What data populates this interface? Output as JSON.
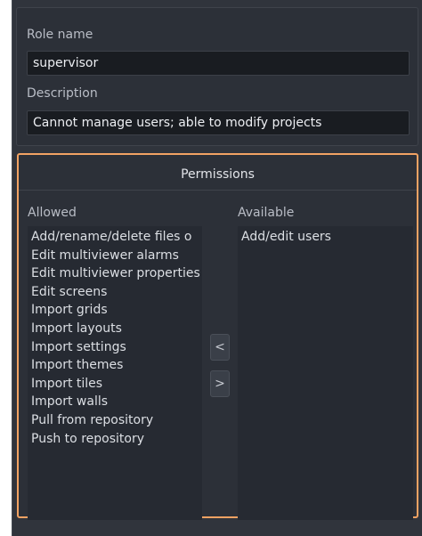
{
  "role": {
    "name_label": "Role name",
    "name_value": "supervisor",
    "description_label": "Description",
    "description_value": "Cannot manage users; able to modify projects"
  },
  "permissions": {
    "title": "Permissions",
    "allowed_label": "Allowed",
    "available_label": "Available",
    "allowed": [
      "Add/rename/delete files o",
      "Edit multiviewer alarms",
      "Edit multiviewer properties",
      "Edit screens",
      "Import grids",
      "Import layouts",
      "Import settings",
      "Import themes",
      "Import tiles",
      "Import walls",
      "Pull from repository",
      "Push to repository"
    ],
    "available": [
      "Add/edit users"
    ],
    "add_button": "<",
    "remove_button": ">"
  },
  "colors": {
    "highlight_border": "#f2a263",
    "panel_bg": "#30343c",
    "input_bg": "#191c21"
  }
}
